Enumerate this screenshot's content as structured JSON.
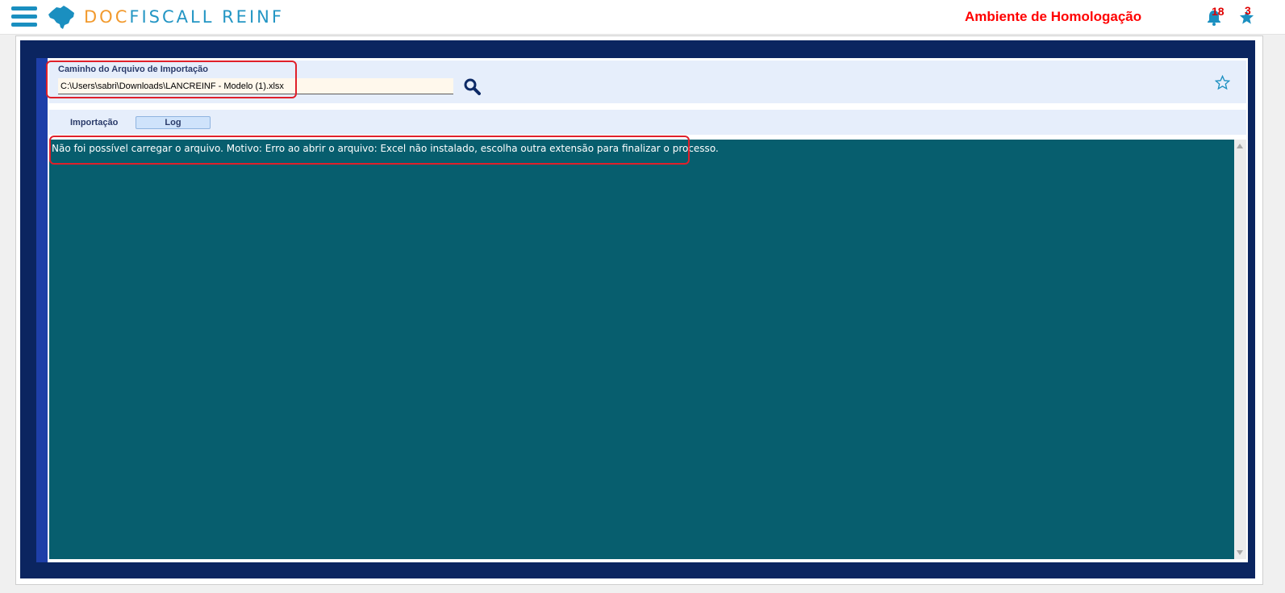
{
  "header": {
    "brand_part1": "DOC",
    "brand_part2": "FISCALL REINF",
    "environment": "Ambiente de Homologação",
    "notifications_count": "18",
    "favorites_count": "3",
    "icons": [
      "menu-icon",
      "brazil-map-logo",
      "bell-icon",
      "star-icon"
    ],
    "colors": {
      "brand_orange": "#f29a2e",
      "brand_blue": "#2496c4",
      "environment_red": "#ff0000"
    }
  },
  "import_form": {
    "file_label": "Caminho do Arquivo de Importação",
    "file_path": "C:\\Users\\sabri\\Downloads\\LANCREINF - Modelo (1).xlsx",
    "search_icon": "magnifier-icon",
    "favorite_icon": "star-outline-icon"
  },
  "tabs": [
    {
      "label": "Importação",
      "active": false
    },
    {
      "label": "Log",
      "active": true
    }
  ],
  "log": {
    "message": "Não foi possível carregar o arquivo. Motivo: Erro ao abrir o arquivo: Excel não instalado, escolha outra extensão para finalizar o processo.",
    "background": "#075e6e"
  }
}
